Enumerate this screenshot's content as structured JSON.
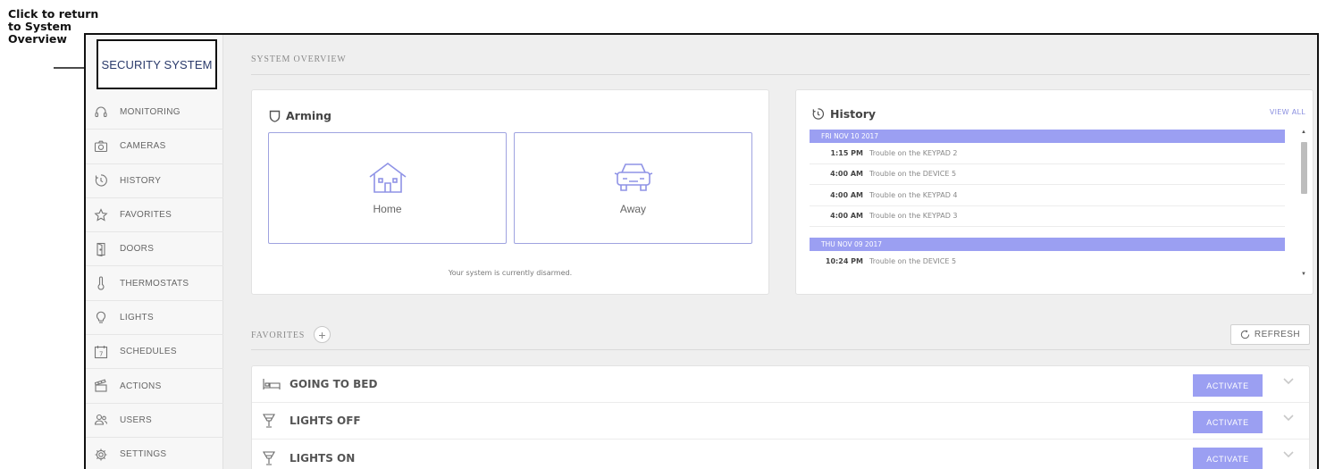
{
  "annotation": {
    "text_lines": [
      "Click to return",
      "to System",
      "Overview"
    ]
  },
  "brand": {
    "title": "SECURITY SYSTEM"
  },
  "sidebar": {
    "items": [
      {
        "label": "MONITORING",
        "icon": "headset-icon"
      },
      {
        "label": "CAMERAS",
        "icon": "camera-icon"
      },
      {
        "label": "HISTORY",
        "icon": "history-icon"
      },
      {
        "label": "FAVORITES",
        "icon": "star-icon"
      },
      {
        "label": "DOORS",
        "icon": "door-icon"
      },
      {
        "label": "THERMOSTATS",
        "icon": "thermometer-icon"
      },
      {
        "label": "LIGHTS",
        "icon": "lightbulb-icon"
      },
      {
        "label": "SCHEDULES",
        "icon": "calendar-icon"
      },
      {
        "label": "ACTIONS",
        "icon": "clapperboard-icon"
      },
      {
        "label": "USERS",
        "icon": "users-icon"
      },
      {
        "label": "SETTINGS",
        "icon": "gear-icon"
      }
    ]
  },
  "overview": {
    "title": "SYSTEM OVERVIEW"
  },
  "arming": {
    "title": "Arming",
    "buttons": [
      {
        "label": "Home",
        "icon": "house-icon"
      },
      {
        "label": "Away",
        "icon": "car-icon"
      }
    ],
    "status": "Your system is currently disarmed."
  },
  "history": {
    "title": "History",
    "view_all": "VIEW ALL",
    "groups": [
      {
        "date": "FRI NOV 10 2017",
        "entries": [
          {
            "time": "1:15 PM",
            "message": "Trouble on the KEYPAD 2"
          },
          {
            "time": "4:00 AM",
            "message": "Trouble on the DEVICE 5"
          },
          {
            "time": "4:00 AM",
            "message": "Trouble on the KEYPAD 4"
          },
          {
            "time": "4:00 AM",
            "message": "Trouble on the KEYPAD 3"
          }
        ]
      },
      {
        "date": "THU NOV 09 2017",
        "entries": [
          {
            "time": "10:24 PM",
            "message": "Trouble on the DEVICE 5"
          }
        ]
      }
    ]
  },
  "favorites": {
    "title": "FAVORITES",
    "add_label": "+",
    "refresh_label": "REFRESH",
    "items": [
      {
        "name": "GOING TO BED",
        "icon": "bed-icon",
        "action_label": "ACTIVATE"
      },
      {
        "name": "LIGHTS OFF",
        "icon": "lamp-icon",
        "action_label": "ACTIVATE"
      },
      {
        "name": "LIGHTS ON",
        "icon": "lamp-icon",
        "action_label": "ACTIVATE"
      }
    ]
  },
  "colors": {
    "accent": "#9b9ff2",
    "brand_text": "#2a3a6b",
    "background": "#efefef"
  }
}
